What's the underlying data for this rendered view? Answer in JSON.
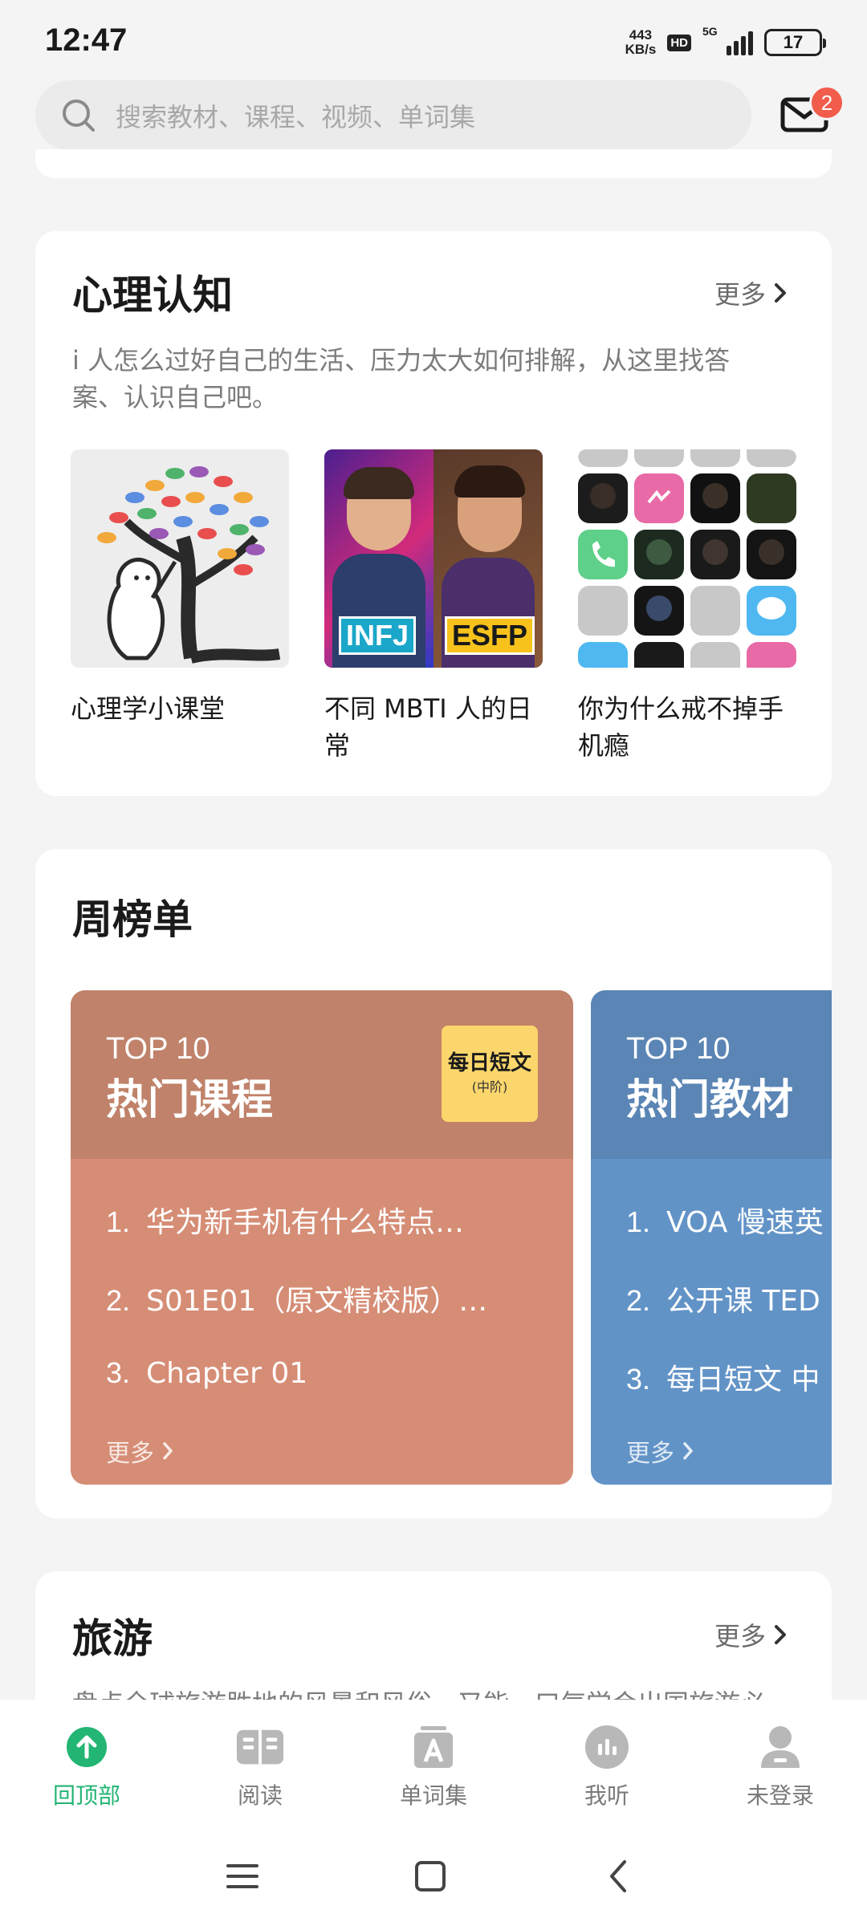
{
  "status": {
    "time": "12:47",
    "net_speed_value": "443",
    "net_speed_unit": "KB/s",
    "hd": "HD",
    "network": "5G",
    "battery": "17"
  },
  "search": {
    "placeholder": "搜索教材、课程、视频、单词集"
  },
  "mail": {
    "badge": "2"
  },
  "psych": {
    "title": "心理认知",
    "more": "更多",
    "description": "i 人怎么过好自己的生活、压力太大如何排解，从这里找答案、认识自己吧。",
    "items": [
      {
        "label": "心理学小课堂"
      },
      {
        "label": "不同 MBTI 人的日常",
        "tag_left": "INFJ",
        "tag_right": "ESFP"
      },
      {
        "label": "你为什么戒不掉手机瘾"
      }
    ]
  },
  "weekly": {
    "title": "周榜单",
    "boards": [
      {
        "top": "TOP 10",
        "title": "热门课程",
        "cover_text": "每日短文",
        "cover_sub": "(中阶)",
        "head_color": "#c0826a",
        "body_color": "#d68d75",
        "items": [
          {
            "num": "1.",
            "text": "华为新手机有什么特点…"
          },
          {
            "num": "2.",
            "text": "S01E01（原文精校版）…"
          },
          {
            "num": "3.",
            "text": "Chapter 01"
          }
        ],
        "more": "更多"
      },
      {
        "top": "TOP 10",
        "title": "热门教材",
        "head_color": "#5a85b5",
        "body_color": "#6293c7",
        "items": [
          {
            "num": "1.",
            "text": "VOA 慢速英"
          },
          {
            "num": "2.",
            "text": "公开课 TED"
          },
          {
            "num": "3.",
            "text": "每日短文 中"
          }
        ],
        "more": "更多"
      }
    ]
  },
  "travel": {
    "title": "旅游",
    "more": "更多",
    "description": "盘点全球旅游胜地的风景和风俗，又能一口气学会出国旅游必"
  },
  "nav": {
    "items": [
      {
        "label": "回顶部",
        "icon": "arrow-up-icon"
      },
      {
        "label": "阅读",
        "icon": "book-icon"
      },
      {
        "label": "单词集",
        "icon": "vocab-icon"
      },
      {
        "label": "我听",
        "icon": "listen-icon"
      },
      {
        "label": "未登录",
        "icon": "user-icon"
      }
    ],
    "active_color": "#22b573",
    "inactive_color": "#b8b8b8"
  }
}
